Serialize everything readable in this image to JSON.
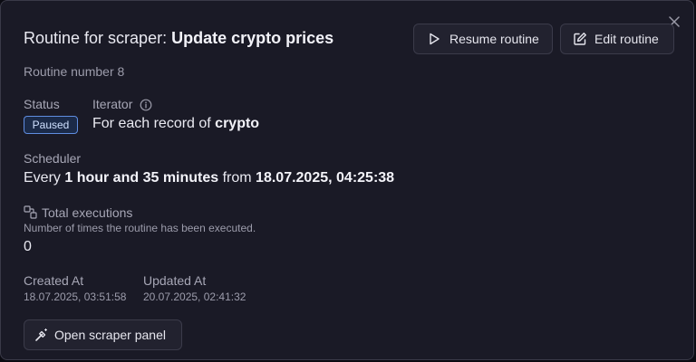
{
  "dialog": {
    "title_prefix": "Routine for scraper: ",
    "title_name": "Update crypto prices",
    "subtitle": "Routine number 8"
  },
  "actions": {
    "resume_label": "Resume routine",
    "edit_label": "Edit routine",
    "open_panel_label": "Open scraper panel"
  },
  "status": {
    "label": "Status",
    "value": "Paused"
  },
  "iterator": {
    "label": "Iterator",
    "prefix": "For each record of ",
    "record": "crypto"
  },
  "scheduler": {
    "label": "Scheduler",
    "every": "Every ",
    "interval": "1 hour and 35 minutes",
    "from": " from ",
    "start": "18.07.2025, 04:25:38"
  },
  "executions": {
    "label": "Total executions",
    "description": "Number of times the routine has been executed.",
    "value": "0"
  },
  "created": {
    "label": "Created At",
    "value": "18.07.2025, 03:51:58"
  },
  "updated": {
    "label": "Updated At",
    "value": "20.07.2025, 02:41:32"
  },
  "icons": {
    "close": "close-icon",
    "resume": "play-icon",
    "edit": "edit-icon",
    "info": "info-icon",
    "executions": "executions-icon",
    "panel": "wand-icon"
  }
}
